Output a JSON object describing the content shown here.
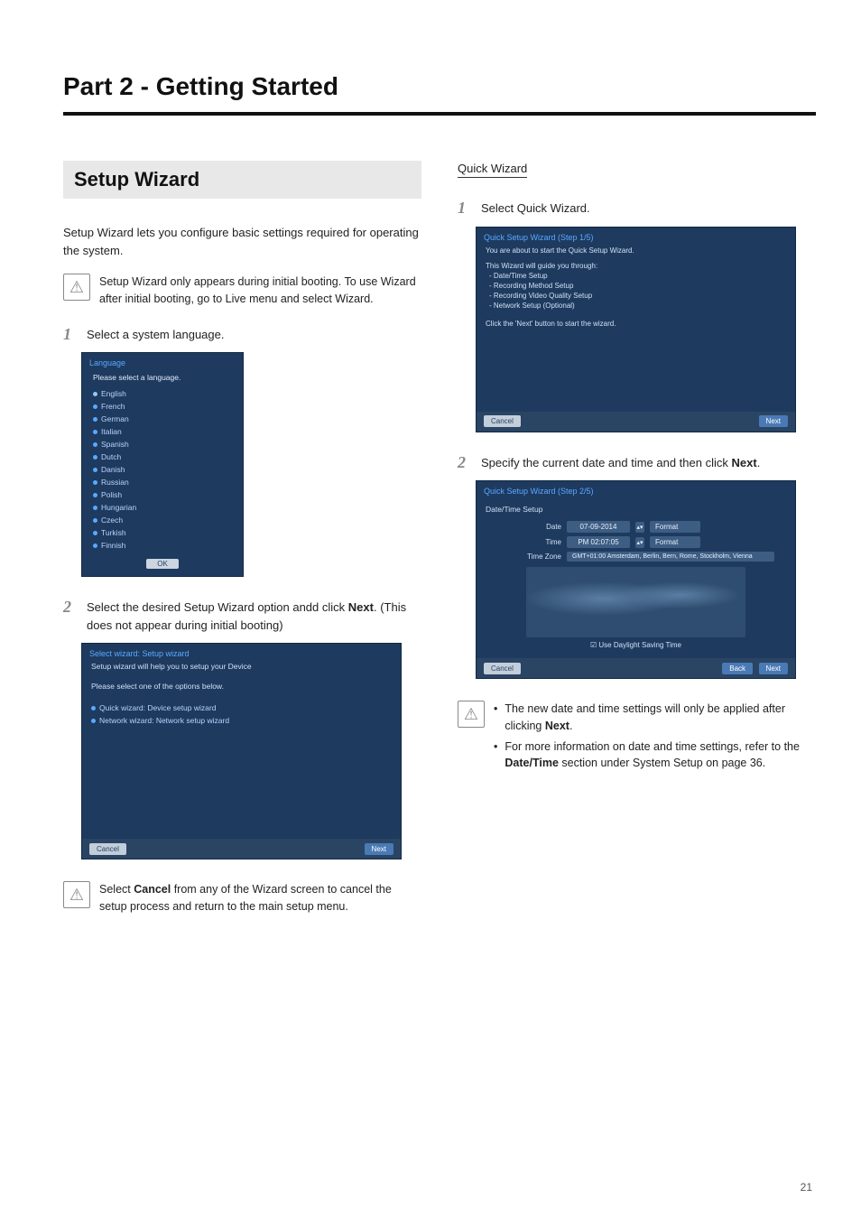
{
  "part_title": "Part 2 - Getting Started",
  "section_title": "Setup Wizard",
  "intro": "Setup Wizard lets you configure basic settings required for operating the system.",
  "note1": "Setup Wizard only appears during initial booting. To use Wizard after initial booting, go to Live menu and select Wizard.",
  "left": {
    "step1_num": "1",
    "step1_text": "Select a system language.",
    "lang_dialog": {
      "title": "Language",
      "prompt": "Please select a language.",
      "items": [
        "English",
        "French",
        "German",
        "Italian",
        "Spanish",
        "Dutch",
        "Danish",
        "Russian",
        "Polish",
        "Hungarian",
        "Czech",
        "Turkish",
        "Finnish"
      ],
      "ok": "OK"
    },
    "step2_num": "2",
    "step2_text_a": "Select the desired Setup Wizard option andd click ",
    "step2_bold": "Next",
    "step2_text_b": ". (This does not appear during initial booting)",
    "select_dialog": {
      "title": "Select wizard: Setup wizard",
      "sub": "Setup wizard will help you to setup your Device",
      "prompt": "Please select one of the options below.",
      "opt1": "Quick wizard: Device setup wizard",
      "opt2": "Network wizard: Network setup wizard",
      "cancel": "Cancel",
      "next": "Next"
    },
    "note2_a": "Select ",
    "note2_bold": "Cancel",
    "note2_b": " from any of the Wizard screen to cancel the setup process and return to the main setup menu."
  },
  "right": {
    "sub_heading": "Quick Wizard",
    "step1_num": "1",
    "step1_text": "Select Quick Wizard.",
    "quick_dialog": {
      "title": "Quick Setup Wizard (Step 1/5)",
      "l1": "You are about to start the Quick Setup Wizard.",
      "l2": "This Wizard will guide you through:",
      "l3": "- Date/Time Setup",
      "l4": "- Recording Method Setup",
      "l5": "- Recording Video Quality Setup",
      "l6": "- Network Setup (Optional)",
      "l7": "Click the 'Next' button to start the wizard.",
      "cancel": "Cancel",
      "next": "Next"
    },
    "step2_num": "2",
    "step2_text_a": "Specify the current date and time and then click ",
    "step2_bold": "Next",
    "step2_text_b": ".",
    "dt_dialog": {
      "title": "Quick Setup Wizard (Step 2/5)",
      "group": "Date/Time Setup",
      "date_lbl": "Date",
      "date_val": "07-09-2014",
      "date_fmt": "Format",
      "time_lbl": "Time",
      "time_val": "PM 02:07:05",
      "time_fmt": "Format",
      "tz_lbl": "Time Zone",
      "tz_val": "GMT+01:00   Amsterdam, Berlin, Bern, Rome, Stockholm, Vienna",
      "dst": "Use Daylight Saving Time",
      "cancel": "Cancel",
      "back": "Back",
      "next": "Next"
    },
    "note_b1_a": "The new date and time settings will only be applied after clicking ",
    "note_b1_bold": "Next",
    "note_b1_b": ".",
    "note_b2_a": "For more information on date and time settings, refer to the ",
    "note_b2_bold": "Date/Time",
    "note_b2_b": " section under System Setup on page 36."
  },
  "page_number": "21"
}
